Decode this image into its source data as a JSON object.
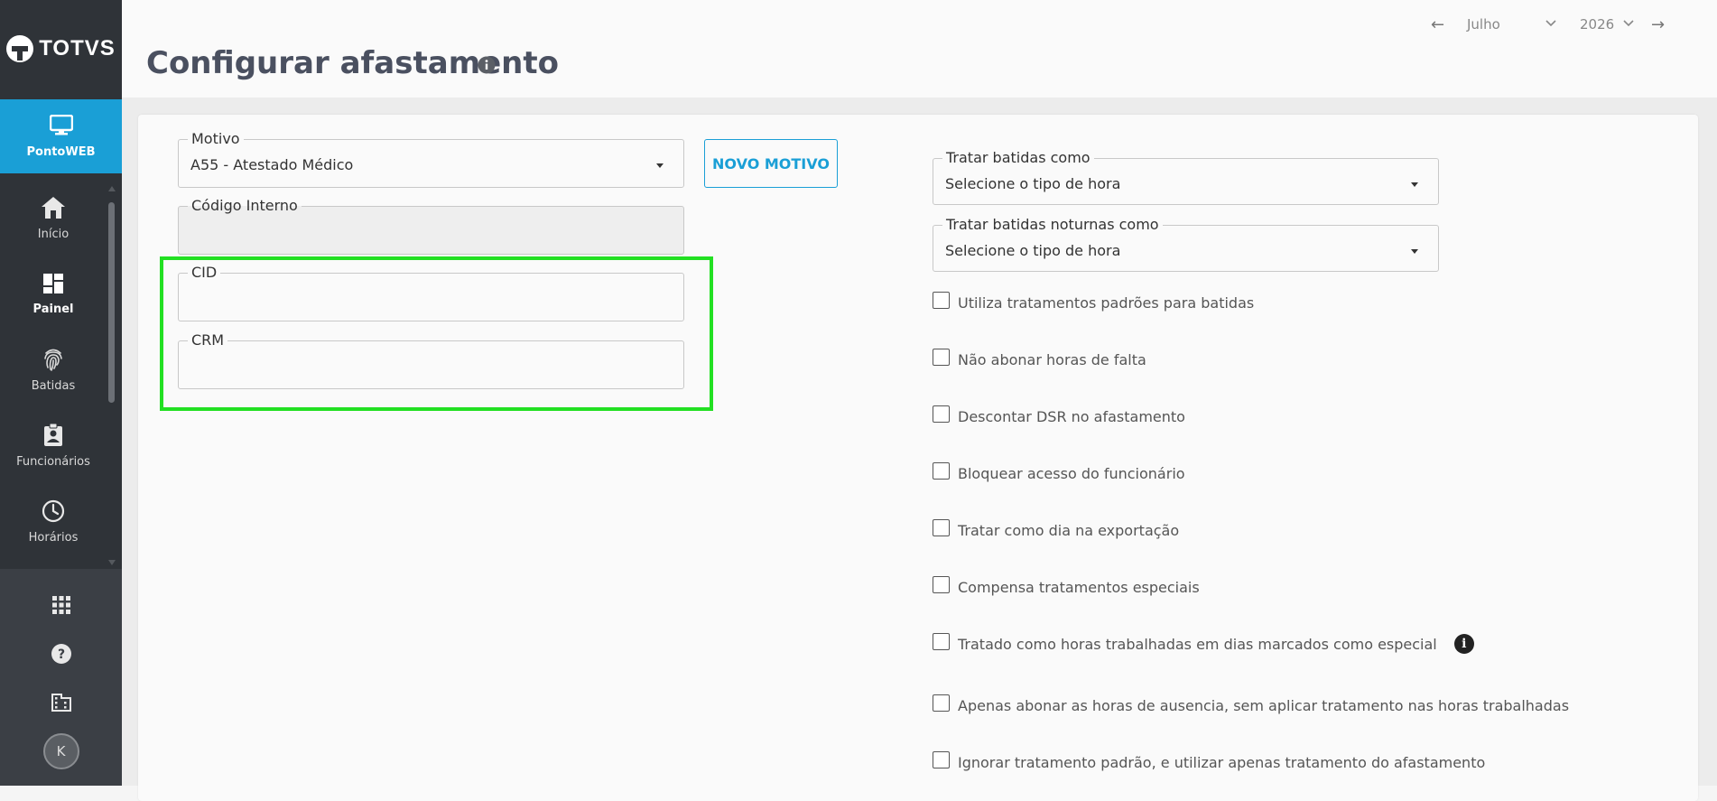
{
  "brand": {
    "name": "TOTVS"
  },
  "sidebar": {
    "active": {
      "label": "PontoWEB",
      "icon": "monitor-icon"
    },
    "items": [
      {
        "label": "Início",
        "icon": "home-icon"
      },
      {
        "label": "Painel",
        "icon": "dashboard-icon"
      },
      {
        "label": "Batidas",
        "icon": "fingerprint-icon"
      },
      {
        "label": "Funcionários",
        "icon": "badge-icon"
      },
      {
        "label": "Horários",
        "icon": "clock-icon"
      }
    ],
    "bottom": [
      {
        "icon": "apps-grid-icon"
      },
      {
        "icon": "help-icon"
      },
      {
        "icon": "building-icon"
      }
    ],
    "avatar_initial": "K"
  },
  "header": {
    "title": "Configurar afastamento",
    "month": "Julho",
    "year": "2026"
  },
  "form": {
    "motivo": {
      "label": "Motivo",
      "value": "A55 - Atestado Médico"
    },
    "novo_motivo_label": "NOVO MOTIVO",
    "codigo_interno": {
      "label": "Código Interno",
      "value": ""
    },
    "cid": {
      "label": "CID",
      "value": ""
    },
    "crm": {
      "label": "CRM",
      "value": ""
    },
    "tratar_batidas": {
      "label": "Tratar batidas como",
      "value": "Selecione o tipo de hora"
    },
    "tratar_noturnas": {
      "label": "Tratar batidas noturnas como",
      "value": "Selecione o tipo de hora"
    },
    "checkboxes": [
      "Utiliza tratamentos padrões para batidas",
      "Não abonar horas de falta",
      "Descontar DSR no afastamento",
      "Bloquear acesso do funcionário",
      "Tratar como dia na exportação",
      "Compensa tratamentos especiais",
      "Tratado como horas trabalhadas em dias marcados como especial",
      "Apenas abonar as horas de ausencia, sem aplicar tratamento nas horas trabalhadas",
      "Ignorar tratamento padrão, e utilizar apenas tratamento do afastamento"
    ]
  },
  "colors": {
    "accent": "#1a9fd6",
    "sidebar": "#2f3338",
    "highlight": "#22e022"
  }
}
